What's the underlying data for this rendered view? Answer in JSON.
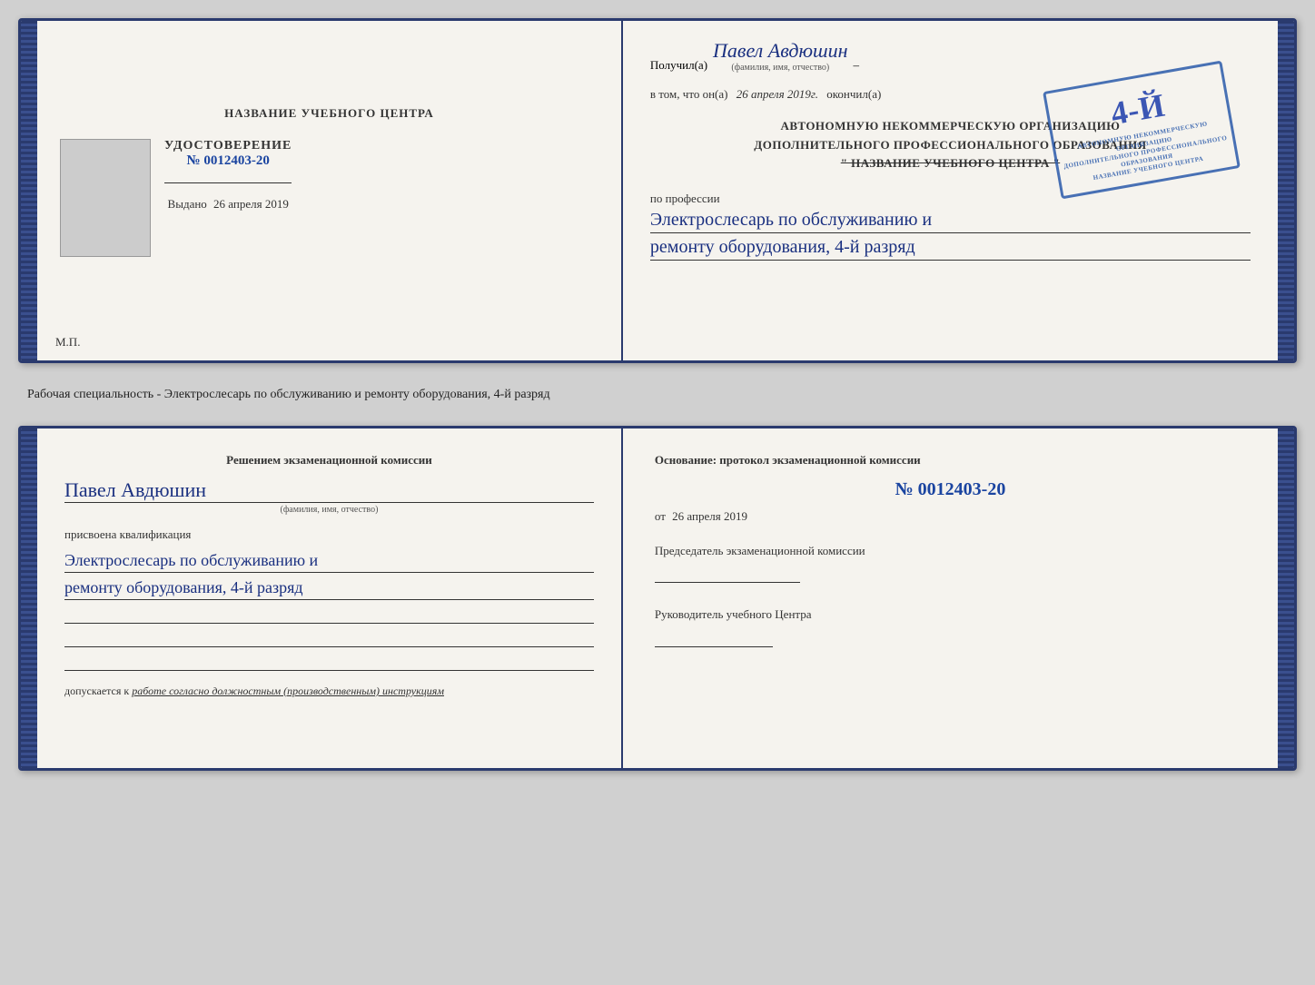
{
  "top_doc": {
    "left": {
      "center_title": "НАЗВАНИЕ УЧЕБНОГО ЦЕНТРА",
      "cert_label": "УДОСТОВЕРЕНИЕ",
      "cert_num": "№ 0012403-20",
      "vydano_label": "Выдано",
      "vydano_date": "26 апреля 2019",
      "mp": "М.П."
    },
    "right": {
      "poluchil_label": "Получил(а)",
      "poluchil_name": "Павел Авдюшин",
      "fio_hint": "(фамилия, имя, отчество)",
      "vtom_label": "в том, что он(а)",
      "vtom_date": "26 апреля 2019г.",
      "okonchil_label": "окончил(а)",
      "org_line1": "АВТОНОМНУЮ НЕКОММЕРЧЕСКУЮ ОРГАНИЗАЦИЮ",
      "org_line2": "ДОПОЛНИТЕЛЬНОГО ПРОФЕССИОНАЛЬНОГО ОБРАЗОВАНИЯ",
      "org_name": "\" НАЗВАНИЕ УЧЕБНОГО ЦЕНТРА \"",
      "po_professii_label": "по профессии",
      "professiya_line1": "Электрослесарь по обслуживанию и",
      "professiya_line2": "ремонту оборудования, 4-й разряд",
      "stamp_number": "4-й",
      "stamp_text": "АВТОНОМНУЮ НЕКОММЕРЧЕСКУЮ ОРГАНИЗАЦИЮ ДОПОЛНИТЕЛЬНОГО ПРОФЕССИОНАЛЬНОГО ОБРАЗОВАНИЯ НАЗВАНИЕ УЧЕБНОГО ЦЕНТРА"
    }
  },
  "middle": {
    "text": "Рабочая специальность - Электрослесарь по обслуживанию и ремонту оборудования, 4-й разряд"
  },
  "bottom_doc": {
    "left": {
      "resheniem_label": "Решением экзаменационной комиссии",
      "fio": "Павел Авдюшин",
      "fio_hint": "(фамилия, имя, отчество)",
      "prisvoena_label": "присвоена квалификация",
      "kvalif_line1": "Электрослесарь по обслуживанию и",
      "kvalif_line2": "ремонту оборудования, 4-й разряд",
      "dopuskaetsya_label": "допускается к",
      "dopuskaetsya_text": "работе согласно должностным (производственным) инструкциям"
    },
    "right": {
      "osnovanie_label": "Основание: протокол экзаменационной комиссии",
      "num_label": "№ 0012403-20",
      "ot_label": "от",
      "ot_date": "26 апреля 2019",
      "predsedatel_label": "Председатель экзаменационной комиссии",
      "rukovoditel_label": "Руководитель учебного Центра"
    }
  }
}
